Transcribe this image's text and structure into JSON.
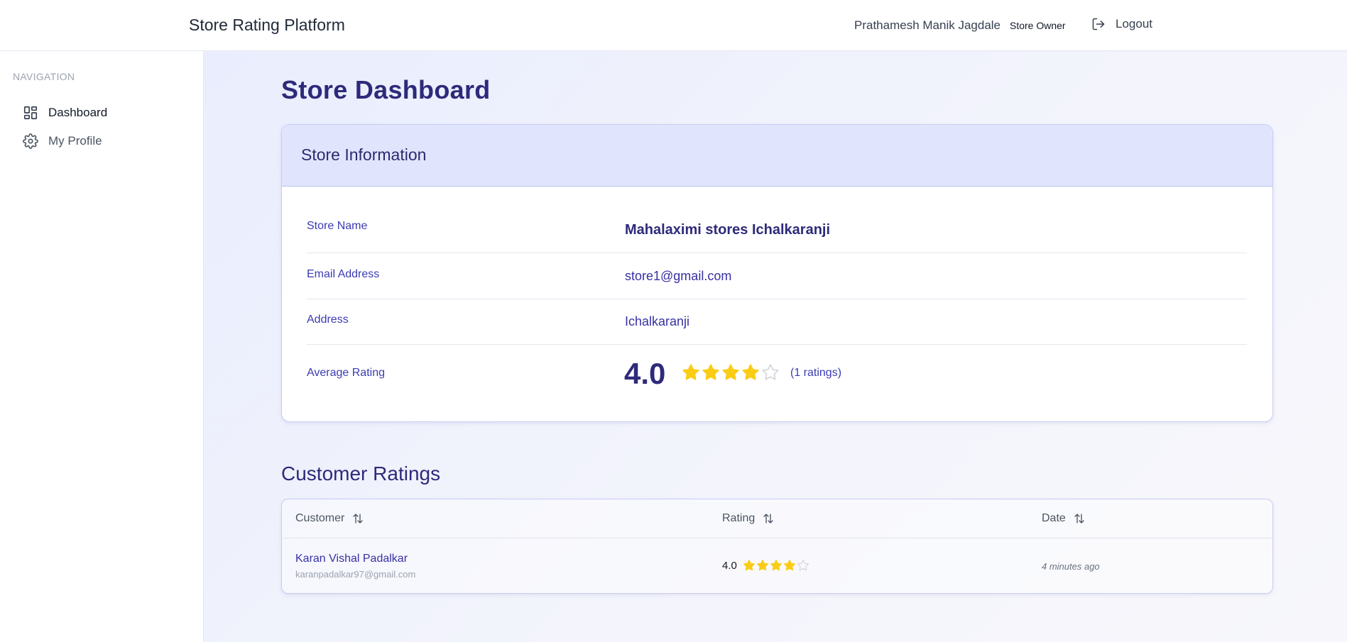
{
  "header": {
    "brand": "Store Rating Platform",
    "user_name": "Prathamesh Manik Jagdale",
    "role": "Store Owner",
    "logout_label": "Logout",
    "logout_icon": "logout-icon"
  },
  "sidebar": {
    "heading": "NAVIGATION",
    "items": [
      {
        "label": "Dashboard",
        "icon": "dashboard-grid-icon",
        "active": true
      },
      {
        "label": "My Profile",
        "icon": "gear-icon",
        "active": false
      }
    ]
  },
  "main": {
    "title": "Store Dashboard",
    "store_info": {
      "title": "Store Information",
      "fields": [
        {
          "label": "Store Name",
          "value": "Mahalaximi stores Ichalkaranji"
        },
        {
          "label": "Email Address",
          "value": "store1@gmail.com"
        },
        {
          "label": "Address",
          "value": "Ichalkaranji"
        },
        {
          "label": "Average Rating",
          "value": "4.0"
        }
      ],
      "average_rating": 4,
      "max_rating": 5,
      "ratings_count": "(1 ratings)"
    },
    "customer_ratings": {
      "title": "Customer Ratings",
      "columns": [
        "Customer",
        "Rating",
        "Date"
      ],
      "rows": [
        {
          "customer_name": "Karan Vishal Padalkar",
          "customer_email": "karanpadalkar97@gmail.com",
          "rating": "4.0",
          "stars": 4,
          "date": "4 minutes ago"
        }
      ]
    }
  },
  "colors": {
    "accent": "#3730a3",
    "title": "#2e2a7a",
    "star_filled": "#facc15",
    "star_empty": "#d1d5db",
    "card_header": "#e0e5fd"
  }
}
